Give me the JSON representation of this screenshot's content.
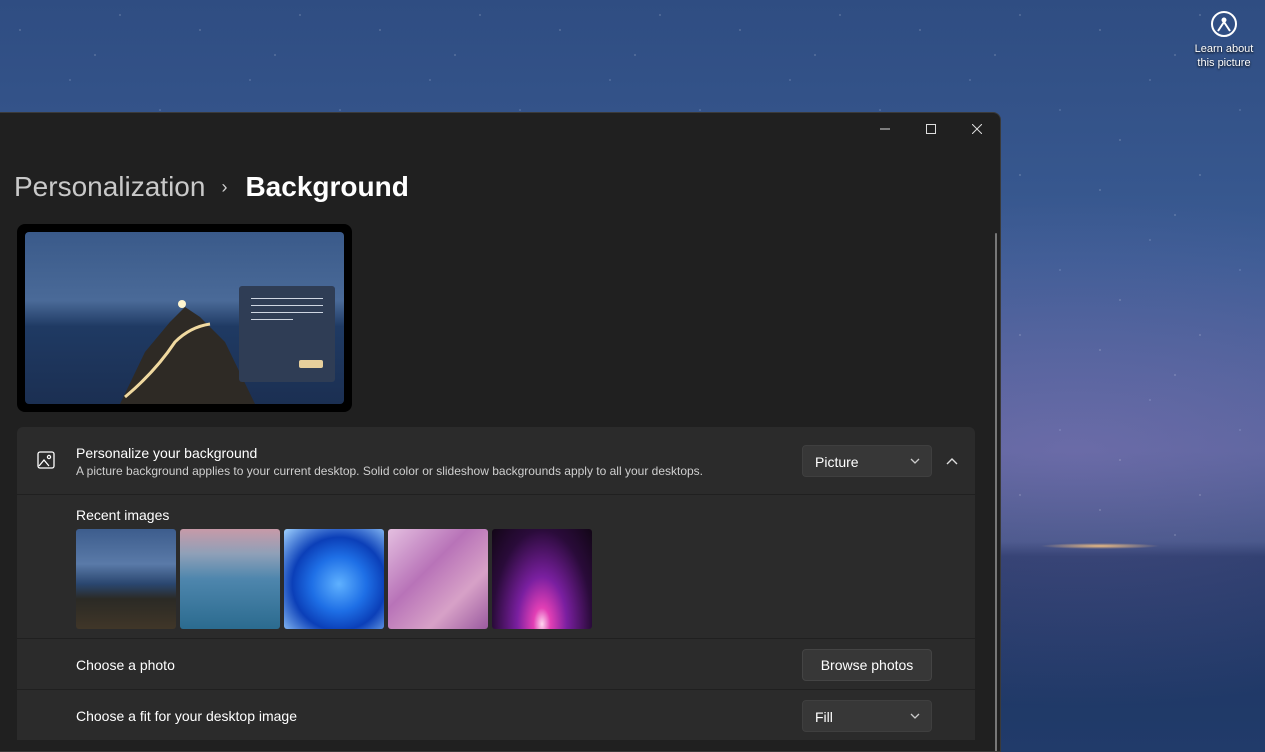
{
  "desktop": {
    "icon_label_line1": "Learn about",
    "icon_label_line2": "this picture"
  },
  "window": {
    "minimize": "—",
    "maximize": "☐",
    "close": "✕"
  },
  "breadcrumb": {
    "parent": "Personalization",
    "separator": "›",
    "current": "Background"
  },
  "personalize": {
    "title": "Personalize your background",
    "description": "A picture background applies to your current desktop. Solid color or slideshow backgrounds apply to all your desktops.",
    "selected": "Picture"
  },
  "recent": {
    "label": "Recent images",
    "images": [
      "lighthouse-night",
      "pier-sunset",
      "windows-bloom-blue",
      "pink-petals",
      "purple-glow"
    ]
  },
  "choose_photo": {
    "label": "Choose a photo",
    "button": "Browse photos"
  },
  "choose_fit": {
    "label": "Choose a fit for your desktop image",
    "selected": "Fill"
  },
  "icons": {
    "desktop": "learn-about-picture-icon",
    "card": "picture-icon",
    "dropdown": "chevron-down-icon",
    "collapse": "chevron-up-icon"
  }
}
